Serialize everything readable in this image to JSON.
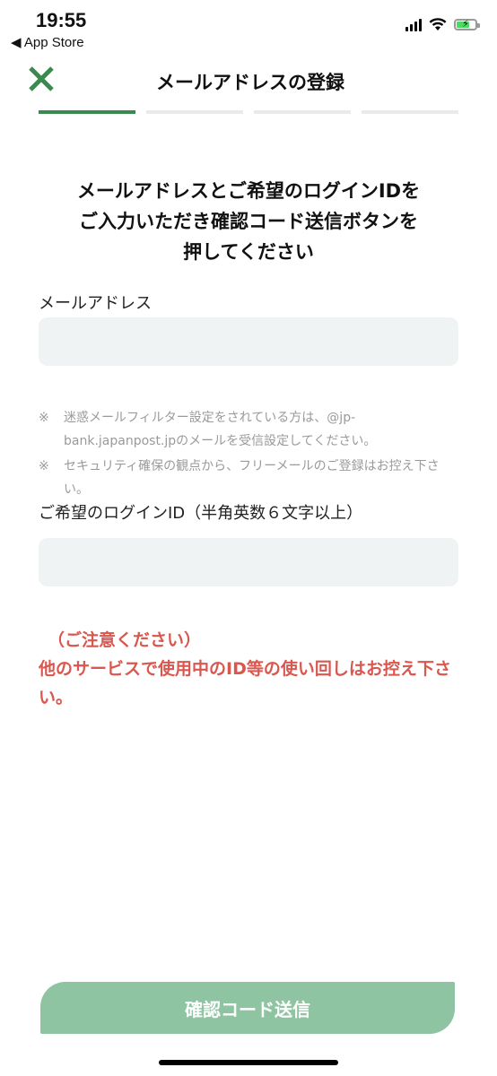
{
  "status_bar": {
    "time": "19:55",
    "back_label": "◀ App Store"
  },
  "header": {
    "title": "メールアドレスの登録",
    "close_icon": "close-icon",
    "accent_color": "#3a8a4f"
  },
  "progress": {
    "total_steps": 4,
    "current_step": 1
  },
  "instruction": "メールアドレスとご希望のログインIDを\nご入力いただき確認コード送信ボタンを\n押してください",
  "email": {
    "label": "メールアドレス",
    "value": "",
    "placeholder": ""
  },
  "notes": [
    {
      "mark": "※",
      "text": "迷惑メールフィルター設定をされている方は、@jp-bank.japanpost.jpのメールを受信設定してください。"
    },
    {
      "mark": "※",
      "text": "セキュリティ確保の観点から、フリーメールのご登録はお控え下さい。"
    }
  ],
  "login_id": {
    "label": "ご希望のログインID（半角英数６文字以上）",
    "value": "",
    "placeholder": ""
  },
  "warning": {
    "heading": "（ご注意ください）",
    "body": "他のサービスで使用中のID等の使い回しはお控え下さい。",
    "color": "#d9574f"
  },
  "submit": {
    "label": "確認コード送信",
    "color": "#8fc4a2"
  }
}
